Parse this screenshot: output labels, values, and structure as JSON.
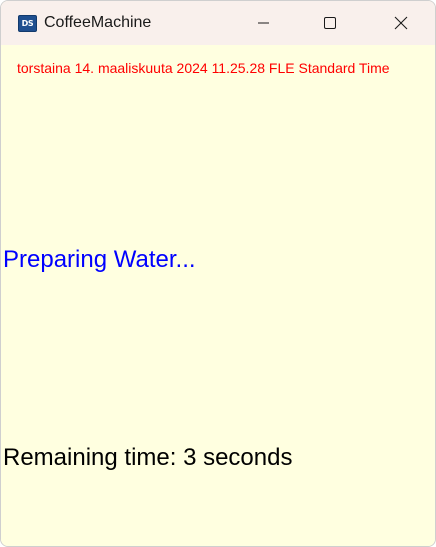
{
  "window": {
    "title": "CoffeeMachine",
    "icon_text": "DS",
    "controls": {
      "minimize": "minimize-icon",
      "maximize": "maximize-icon",
      "close": "close-icon"
    }
  },
  "content": {
    "datetime": "torstaina 14. maaliskuuta 2024 11.25.28 FLE Standard Time",
    "status": "Preparing Water...",
    "remaining": "Remaining time: 3 seconds"
  },
  "colors": {
    "background": "#ffffe0",
    "titlebar": "#f9f0ec",
    "datetime": "#ff0000",
    "status": "#0000ff",
    "remaining": "#000000"
  }
}
